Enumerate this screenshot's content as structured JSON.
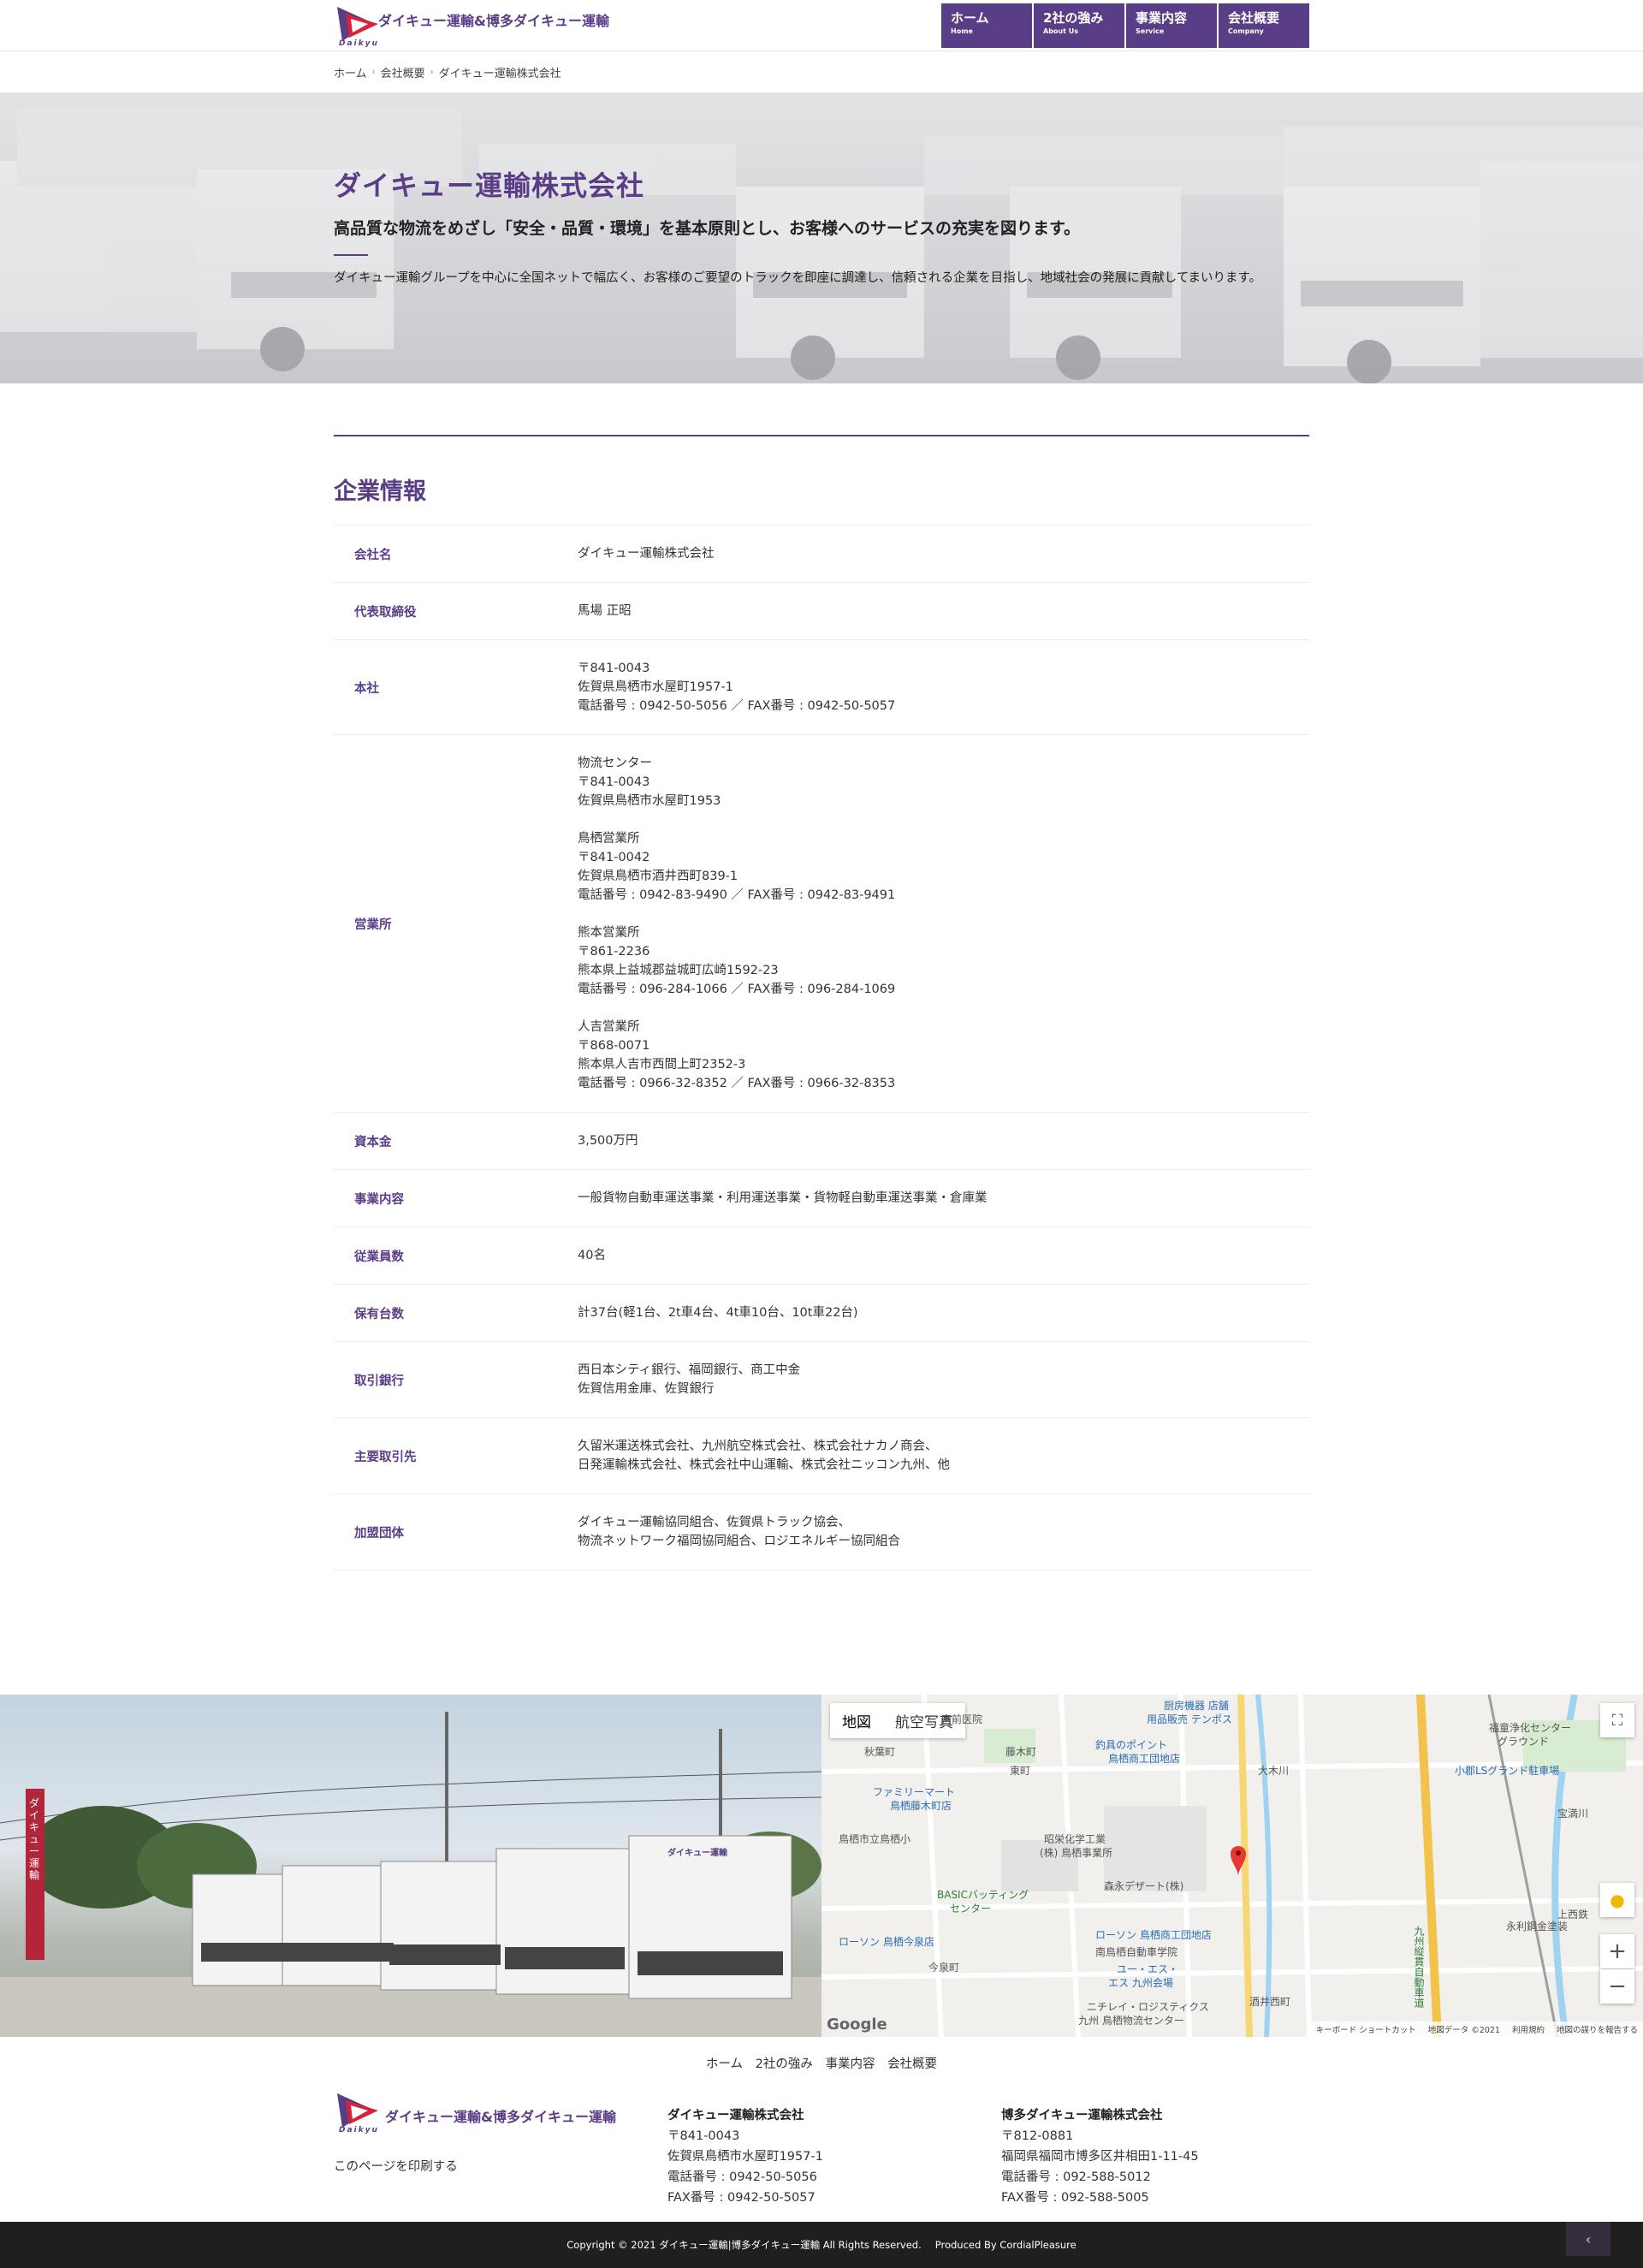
{
  "header": {
    "logo_text": "ダイキュー運輸&博多ダイキュー運輸",
    "logo_sub": "Daikyu",
    "nav": [
      {
        "ja": "ホーム",
        "en": "Home"
      },
      {
        "ja": "2社の強み",
        "en": "About Us"
      },
      {
        "ja": "事業内容",
        "en": "Service"
      },
      {
        "ja": "会社概要",
        "en": "Company"
      }
    ]
  },
  "breadcrumb": [
    "ホーム",
    "会社概要",
    "ダイキュー運輸株式会社"
  ],
  "hero": {
    "title": "ダイキュー運輸株式会社",
    "subtitle": "高品質な物流をめざし「安全・品質・環境」を基本原則とし、お客様へのサービスの充実を図ります。",
    "description": "ダイキュー運輸グループを中心に全国ネットで幅広く、お客様のご要望のトラックを即座に調達し、信頼される企業を目指し、地域社会の発展に貢献してまいります。"
  },
  "company": {
    "heading": "企業情報",
    "rows": [
      {
        "label": "会社名",
        "lines": [
          "ダイキュー運輸株式会社"
        ]
      },
      {
        "label": "代表取締役",
        "lines": [
          "馬場 正昭"
        ]
      },
      {
        "label": "本社",
        "lines": [
          "〒841-0043",
          "佐賀県鳥栖市水屋町1957-1",
          "電話番号 : 0942-50-5056 ／ FAX番号 : 0942-50-5057"
        ]
      },
      {
        "label": "営業所",
        "lines": [
          "物流センター",
          "〒841-0043",
          "佐賀県鳥栖市水屋町1953",
          "",
          "鳥栖営業所",
          "〒841-0042",
          "佐賀県鳥栖市酒井西町839-1",
          "電話番号 : 0942-83-9490 ／ FAX番号 : 0942-83-9491",
          "",
          "熊本営業所",
          "〒861-2236",
          "熊本県上益城郡益城町広崎1592-23",
          "電話番号 : 096-284-1066 ／ FAX番号 : 096-284-1069",
          "",
          "人吉営業所",
          "〒868-0071",
          "熊本県人吉市西間上町2352-3",
          "電話番号 : 0966-32-8352 ／ FAX番号 : 0966-32-8353"
        ]
      },
      {
        "label": "資本金",
        "lines": [
          "3,500万円"
        ]
      },
      {
        "label": "事業内容",
        "lines": [
          "一般貨物自動車運送事業・利用運送事業・貨物軽自動車運送事業・倉庫業"
        ]
      },
      {
        "label": "従業員数",
        "lines": [
          "40名"
        ]
      },
      {
        "label": "保有台数",
        "lines": [
          "計37台(軽1台、2t車4台、4t車10台、10t車22台)"
        ]
      },
      {
        "label": "取引銀行",
        "lines": [
          "西日本シティ銀行、福岡銀行、商工中金",
          "佐賀信用金庫、佐賀銀行"
        ]
      },
      {
        "label": "主要取引先",
        "lines": [
          "久留米運送株式会社、九州航空株式会社、株式会社ナカノ商会、",
          "日発運輸株式会社、株式会社中山運輸、株式会社ニッコン九州、他"
        ]
      },
      {
        "label": "加盟団体",
        "lines": [
          "ダイキュー運輸協同組合、佐賀県トラック協会、",
          "物流ネットワーク福岡協同組合、ロジエネルギー協同組合"
        ]
      }
    ]
  },
  "photo": {
    "sign_text": "ダイキュー運輸",
    "truck_badge": "ダイキュー運輸"
  },
  "map": {
    "tab_map": "地図",
    "tab_satellite": "航空写真",
    "labels": [
      {
        "text": "ファミリーマート",
        "cls": "blue"
      },
      {
        "text": "鳥栖藤木町店",
        "cls": "blue"
      },
      {
        "text": "鳥栖市立鳥栖小",
        "cls": ""
      },
      {
        "text": "BASICバッティング",
        "cls": "green"
      },
      {
        "text": "センター",
        "cls": "green"
      },
      {
        "text": "ローソン 鳥栖今泉店",
        "cls": "blue"
      },
      {
        "text": "昭栄化学工業",
        "cls": ""
      },
      {
        "text": "(株) 鳥栖事業所",
        "cls": ""
      },
      {
        "text": "森永デザート(株)",
        "cls": ""
      },
      {
        "text": "ローソン 鳥栖商工団地店",
        "cls": "blue"
      },
      {
        "text": "南鳥栖自動車学院",
        "cls": ""
      },
      {
        "text": "ユー・エス・",
        "cls": "blue"
      },
      {
        "text": "エス 九州会場",
        "cls": "blue"
      },
      {
        "text": "ニチレイ・ロジスティクス",
        "cls": ""
      },
      {
        "text": "九州 鳥栖物流センター",
        "cls": ""
      },
      {
        "text": "釣具のポイント",
        "cls": "blue"
      },
      {
        "text": "鳥栖商工団地店",
        "cls": "blue"
      },
      {
        "text": "厨房機器 店舗",
        "cls": "blue"
      },
      {
        "text": "用品販売 テンポス",
        "cls": "blue"
      },
      {
        "text": "福童浄化センター",
        "cls": ""
      },
      {
        "text": "グラウンド",
        "cls": ""
      },
      {
        "text": "小郡LSグランド駐車場",
        "cls": "blue"
      },
      {
        "text": "永利鋼金塗装",
        "cls": ""
      },
      {
        "text": "九州縦貫自動車道",
        "cls": "green"
      },
      {
        "text": "秋葉町",
        "cls": ""
      },
      {
        "text": "今泉町",
        "cls": ""
      },
      {
        "text": "酒井西町",
        "cls": ""
      },
      {
        "text": "大木川",
        "cls": ""
      },
      {
        "text": "宝満川",
        "cls": ""
      },
      {
        "text": "上西鉄",
        "cls": ""
      },
      {
        "text": "宮前医院",
        "cls": ""
      },
      {
        "text": "藤木町",
        "cls": ""
      },
      {
        "text": "東町",
        "cls": ""
      }
    ],
    "google": "Google",
    "footer": [
      "キーボード ショートカット",
      "地図データ ©2021",
      "利用規約",
      "地図の誤りを報告する"
    ],
    "zoom_in": "+",
    "zoom_out": "−"
  },
  "footer": {
    "nav": [
      "ホーム",
      "2社の強み",
      "事業内容",
      "会社概要"
    ],
    "logo_text": "ダイキュー運輸&博多ダイキュー運輸",
    "logo_sub": "Daikyu",
    "print": "このページを印刷する",
    "company1": {
      "name": "ダイキュー運輸株式会社",
      "lines": [
        "〒841-0043",
        "佐賀県鳥栖市水屋町1957-1",
        "電話番号 : 0942-50-5056",
        "FAX番号 : 0942-50-5057"
      ]
    },
    "company2": {
      "name": "博多ダイキュー運輸株式会社",
      "lines": [
        "〒812-0881",
        "福岡県福岡市博多区井相田1-11-45",
        "電話番号 : 092-588-5012",
        "FAX番号 : 092-588-5005"
      ]
    },
    "copyright": "Copyright © 2021 ダイキュー運輸|博多ダイキュー運輸 All Rights Reserved.",
    "produced": "Produced By CordialPleasure"
  },
  "colors": {
    "brand": "#5a3d87",
    "footer_bg": "#1f1f1f"
  }
}
